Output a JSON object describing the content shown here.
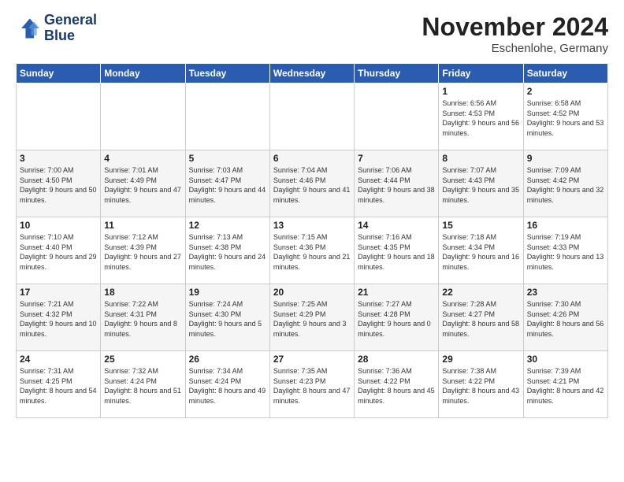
{
  "header": {
    "logo_line1": "General",
    "logo_line2": "Blue",
    "month_title": "November 2024",
    "location": "Eschenlohe, Germany"
  },
  "weekdays": [
    "Sunday",
    "Monday",
    "Tuesday",
    "Wednesday",
    "Thursday",
    "Friday",
    "Saturday"
  ],
  "weeks": [
    [
      {
        "day": "",
        "info": ""
      },
      {
        "day": "",
        "info": ""
      },
      {
        "day": "",
        "info": ""
      },
      {
        "day": "",
        "info": ""
      },
      {
        "day": "",
        "info": ""
      },
      {
        "day": "1",
        "info": "Sunrise: 6:56 AM\nSunset: 4:53 PM\nDaylight: 9 hours and 56 minutes."
      },
      {
        "day": "2",
        "info": "Sunrise: 6:58 AM\nSunset: 4:52 PM\nDaylight: 9 hours and 53 minutes."
      }
    ],
    [
      {
        "day": "3",
        "info": "Sunrise: 7:00 AM\nSunset: 4:50 PM\nDaylight: 9 hours and 50 minutes."
      },
      {
        "day": "4",
        "info": "Sunrise: 7:01 AM\nSunset: 4:49 PM\nDaylight: 9 hours and 47 minutes."
      },
      {
        "day": "5",
        "info": "Sunrise: 7:03 AM\nSunset: 4:47 PM\nDaylight: 9 hours and 44 minutes."
      },
      {
        "day": "6",
        "info": "Sunrise: 7:04 AM\nSunset: 4:46 PM\nDaylight: 9 hours and 41 minutes."
      },
      {
        "day": "7",
        "info": "Sunrise: 7:06 AM\nSunset: 4:44 PM\nDaylight: 9 hours and 38 minutes."
      },
      {
        "day": "8",
        "info": "Sunrise: 7:07 AM\nSunset: 4:43 PM\nDaylight: 9 hours and 35 minutes."
      },
      {
        "day": "9",
        "info": "Sunrise: 7:09 AM\nSunset: 4:42 PM\nDaylight: 9 hours and 32 minutes."
      }
    ],
    [
      {
        "day": "10",
        "info": "Sunrise: 7:10 AM\nSunset: 4:40 PM\nDaylight: 9 hours and 29 minutes."
      },
      {
        "day": "11",
        "info": "Sunrise: 7:12 AM\nSunset: 4:39 PM\nDaylight: 9 hours and 27 minutes."
      },
      {
        "day": "12",
        "info": "Sunrise: 7:13 AM\nSunset: 4:38 PM\nDaylight: 9 hours and 24 minutes."
      },
      {
        "day": "13",
        "info": "Sunrise: 7:15 AM\nSunset: 4:36 PM\nDaylight: 9 hours and 21 minutes."
      },
      {
        "day": "14",
        "info": "Sunrise: 7:16 AM\nSunset: 4:35 PM\nDaylight: 9 hours and 18 minutes."
      },
      {
        "day": "15",
        "info": "Sunrise: 7:18 AM\nSunset: 4:34 PM\nDaylight: 9 hours and 16 minutes."
      },
      {
        "day": "16",
        "info": "Sunrise: 7:19 AM\nSunset: 4:33 PM\nDaylight: 9 hours and 13 minutes."
      }
    ],
    [
      {
        "day": "17",
        "info": "Sunrise: 7:21 AM\nSunset: 4:32 PM\nDaylight: 9 hours and 10 minutes."
      },
      {
        "day": "18",
        "info": "Sunrise: 7:22 AM\nSunset: 4:31 PM\nDaylight: 9 hours and 8 minutes."
      },
      {
        "day": "19",
        "info": "Sunrise: 7:24 AM\nSunset: 4:30 PM\nDaylight: 9 hours and 5 minutes."
      },
      {
        "day": "20",
        "info": "Sunrise: 7:25 AM\nSunset: 4:29 PM\nDaylight: 9 hours and 3 minutes."
      },
      {
        "day": "21",
        "info": "Sunrise: 7:27 AM\nSunset: 4:28 PM\nDaylight: 9 hours and 0 minutes."
      },
      {
        "day": "22",
        "info": "Sunrise: 7:28 AM\nSunset: 4:27 PM\nDaylight: 8 hours and 58 minutes."
      },
      {
        "day": "23",
        "info": "Sunrise: 7:30 AM\nSunset: 4:26 PM\nDaylight: 8 hours and 56 minutes."
      }
    ],
    [
      {
        "day": "24",
        "info": "Sunrise: 7:31 AM\nSunset: 4:25 PM\nDaylight: 8 hours and 54 minutes."
      },
      {
        "day": "25",
        "info": "Sunrise: 7:32 AM\nSunset: 4:24 PM\nDaylight: 8 hours and 51 minutes."
      },
      {
        "day": "26",
        "info": "Sunrise: 7:34 AM\nSunset: 4:24 PM\nDaylight: 8 hours and 49 minutes."
      },
      {
        "day": "27",
        "info": "Sunrise: 7:35 AM\nSunset: 4:23 PM\nDaylight: 8 hours and 47 minutes."
      },
      {
        "day": "28",
        "info": "Sunrise: 7:36 AM\nSunset: 4:22 PM\nDaylight: 8 hours and 45 minutes."
      },
      {
        "day": "29",
        "info": "Sunrise: 7:38 AM\nSunset: 4:22 PM\nDaylight: 8 hours and 43 minutes."
      },
      {
        "day": "30",
        "info": "Sunrise: 7:39 AM\nSunset: 4:21 PM\nDaylight: 8 hours and 42 minutes."
      }
    ]
  ]
}
